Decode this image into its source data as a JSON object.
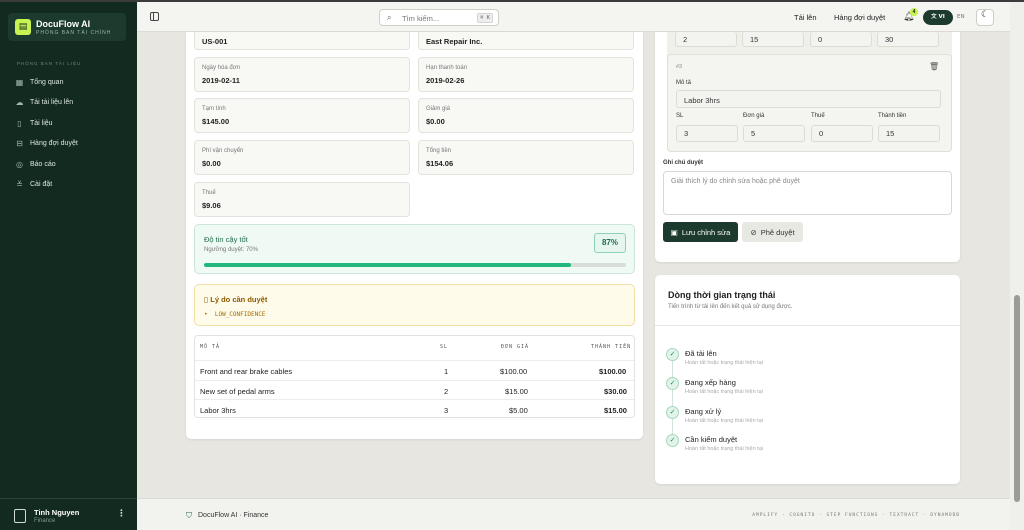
{
  "sidebar": {
    "brand": "DocuFlow AI",
    "brand_sub": "PHÒNG BAN TÀI CHÍNH",
    "section": "PHÒNG BAN TÀI LIỆU",
    "items": [
      {
        "label": "Tổng quan",
        "icon": "grid-icon"
      },
      {
        "label": "Tải tài liệu lên",
        "icon": "upload-cloud-icon"
      },
      {
        "label": "Tài liệu",
        "icon": "document-icon"
      },
      {
        "label": "Hàng đợi duyệt",
        "icon": "inbox-icon"
      },
      {
        "label": "Báo cáo",
        "icon": "chart-icon"
      },
      {
        "label": "Cài đặt",
        "icon": "sliders-icon"
      }
    ],
    "user": {
      "name": "Tinh Nguyen",
      "role": "Finance"
    }
  },
  "header": {
    "search_placeholder": "Tìm kiếm...",
    "search_shortcut": "⌘ K",
    "upload": "Tải lên",
    "review_queue": "Hàng đợi duyệt",
    "notif_count": "4",
    "lang_active": "VI",
    "lang_other": "EN"
  },
  "fields": [
    {
      "label": "",
      "value": "US-001"
    },
    {
      "label": "",
      "value": "East Repair Inc."
    },
    {
      "label": "Ngày hóa đơn",
      "value": "2019-02-11"
    },
    {
      "label": "Hạn thanh toán",
      "value": "2019-02-26"
    },
    {
      "label": "Tạm tính",
      "value": "$145.00"
    },
    {
      "label": "Giảm giá",
      "value": "$0.00"
    },
    {
      "label": "Phí vận chuyển",
      "value": "$0.00"
    },
    {
      "label": "Tổng tiền",
      "value": "$154.06"
    },
    {
      "label": "Thuế",
      "value": "$9.06"
    }
  ],
  "confidence": {
    "title": "Độ tin cậy tốt",
    "threshold": "Ngưỡng duyệt: 70%",
    "percent_label": "87%",
    "value": 0.87
  },
  "review_reason": {
    "title": "Lý do cần duyệt",
    "item": "LOW_CONFIDENCE"
  },
  "line_table": {
    "headers": [
      "MÔ TẢ",
      "SL",
      "ĐƠN GIÁ",
      "THÀNH TIỀN"
    ],
    "rows": [
      [
        "Front and rear brake cables",
        "1",
        "$100.00",
        "$100.00"
      ],
      [
        "New set of pedal arms",
        "2",
        "$15.00",
        "$30.00"
      ],
      [
        "Labor 3hrs",
        "3",
        "$5.00",
        "$15.00"
      ]
    ]
  },
  "editor": {
    "prev_row": [
      "2",
      "15",
      "0",
      "30"
    ],
    "item_index": "#3",
    "desc_label": "Mô tả",
    "desc_value": "Labor 3hrs",
    "col_labels": [
      "SL",
      "Đơn giá",
      "Thuế",
      "Thành tiền"
    ],
    "row_values": [
      "3",
      "5",
      "0",
      "15"
    ],
    "notes_label": "Ghi chú duyệt",
    "notes_placeholder": "Giải thích lý do chỉnh sửa hoặc phê duyệt",
    "save": "Lưu chỉnh sửa",
    "approve": "Phê duyệt"
  },
  "timeline": {
    "title": "Dòng thời gian trạng thái",
    "subtitle": "Tiến trình từ tải lên đến kết quả sử dụng được.",
    "steps": [
      {
        "name": "Đã tải lên",
        "desc": "Hoàn tất hoặc trạng thái hiện tại"
      },
      {
        "name": "Đang xếp hàng",
        "desc": "Hoàn tất hoặc trạng thái hiện tại"
      },
      {
        "name": "Đang xử lý",
        "desc": "Hoàn tất hoặc trạng thái hiện tại"
      },
      {
        "name": "Cần kiểm duyệt",
        "desc": "Hoàn tất hoặc trạng thái hiện tại"
      }
    ]
  },
  "footer": {
    "text": "DocuFlow AI · Finance",
    "stack": "AMPLIFY · COGNITO · STEP FUNCTIONS · TEXTRACT · DYNAMODB"
  },
  "colors": {
    "sidebar": "#132a20",
    "accent": "#c6f34f",
    "success": "#21b77c",
    "warning_bg": "#fffbea"
  }
}
